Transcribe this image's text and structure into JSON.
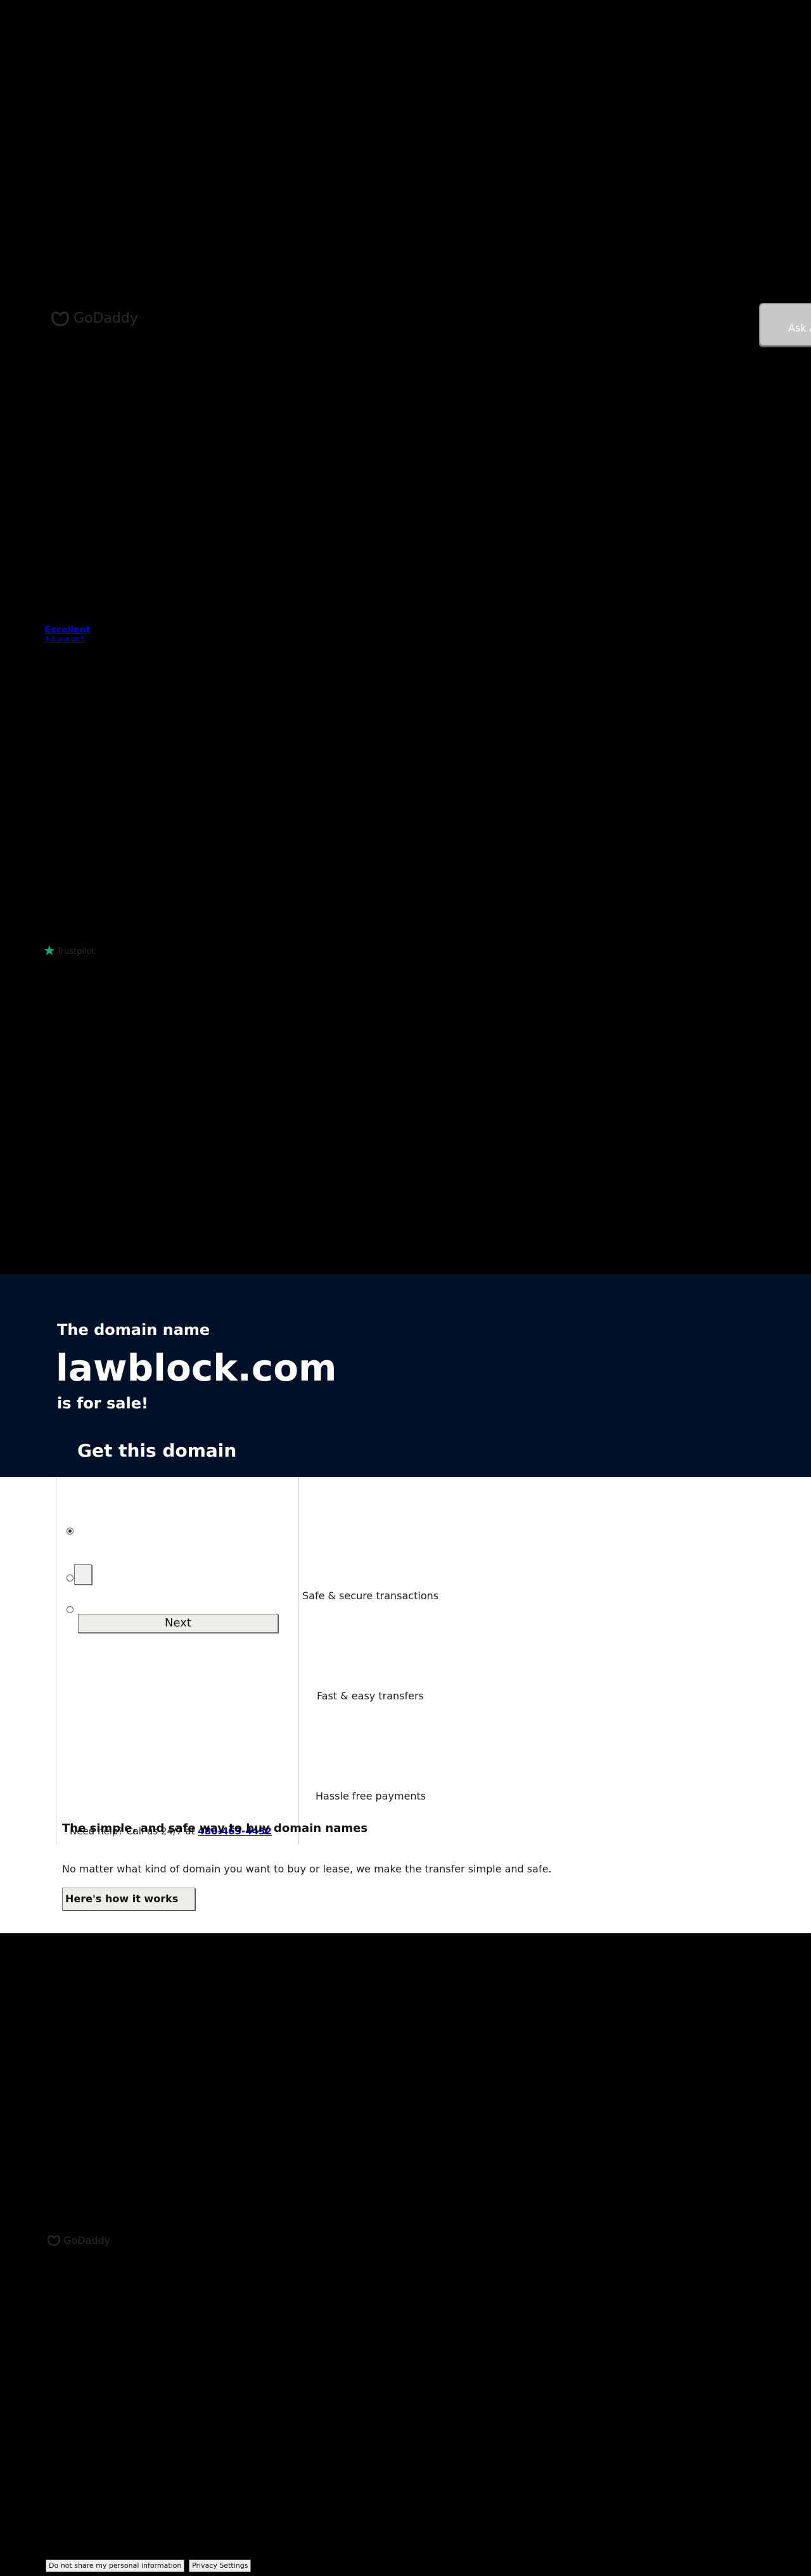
{
  "header": {
    "logo_text": "GoDaddy",
    "ask_button": "Ask A"
  },
  "rating": {
    "label": "Excellent",
    "sub": "4.6 out of 5"
  },
  "trustpilot": {
    "logo_text": "Trustpilot"
  },
  "hero": {
    "pre_title": "The domain name",
    "domain": "lawblock.com",
    "post_title": "is for sale!",
    "cta": "Get this domain"
  },
  "offer": {
    "next_label": "Next",
    "help_text": "Need help? Call us 24/7 at",
    "help_phone": "480-463-4432"
  },
  "features": [
    {
      "label": "Safe & secure transactions"
    },
    {
      "label": "Fast & easy transfers"
    },
    {
      "label": "Hassle free payments"
    }
  ],
  "info": {
    "title": "The simple, and safe way to buy domain names",
    "description": "No matter what kind of domain you want to buy or lease, we make the transfer simple and safe.",
    "how_button": "Here's how it works"
  },
  "footer": {
    "logo_text": "GoDaddy",
    "do_not_share": "Do not share my personal information",
    "privacy_settings": "Privacy Settings"
  },
  "colors": {
    "page_bg": "#000000",
    "hero_bg": "#01112a",
    "link": "#0000ee",
    "trustpilot_star": "#00b67a"
  }
}
